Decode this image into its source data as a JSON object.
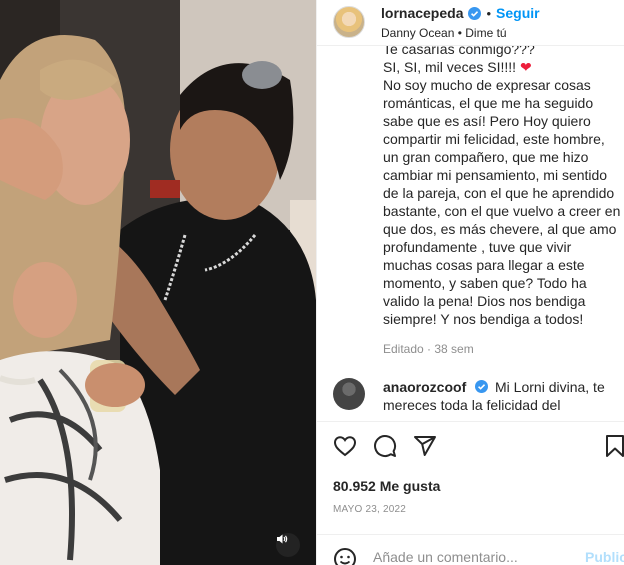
{
  "post": {
    "author": "lornacepeda",
    "follow_label": "Seguir",
    "separator": "•",
    "audio": "Danny Ocean • Dime tú",
    "more": "···",
    "caption_lines": [
      "Te casarías conmigo???",
      "SI, SI, mil veces SI!!!!",
      "No soy mucho de expresar cosas",
      "románticas, el que me ha seguido",
      "sabe que es así! Pero Hoy quiero",
      "compartir mi felicidad, este hombre,",
      "un gran compañero, que me hizo",
      "cambiar mi pensamiento, mi sentido",
      "de la pareja, con el que he aprendido",
      "bastante, con el que vuelvo a creer en",
      "que dos, es más chevere, al que amo",
      "profundamente , tuve que vivir",
      "muchas cosas para llegar a este",
      "momento, y saben que? Todo ha",
      "valido la pena! Dios nos bendiga",
      "siempre! Y nos bendiga a todos!"
    ],
    "heart_emoji": "❤",
    "edited": "Editado · 38 sem",
    "likes": "80.952 Me gusta",
    "date": "MAYO 23, 2022"
  },
  "comment": {
    "user": "anaorozcoof",
    "text_line1": "Mi Lorni divina, te",
    "text_line2": "mereces toda la felicidad del"
  },
  "composer": {
    "placeholder": "Añade un comentario...",
    "post_label": "Publicar"
  },
  "colors": {
    "accent": "#0095f6",
    "heart": "#ed1e3b",
    "verified": "#3897f0"
  },
  "icons": {
    "like": "heart-icon",
    "comment": "comment-icon",
    "share": "share-icon",
    "save": "bookmark-icon",
    "emoji": "emoji-icon",
    "mute": "speaker-icon"
  }
}
